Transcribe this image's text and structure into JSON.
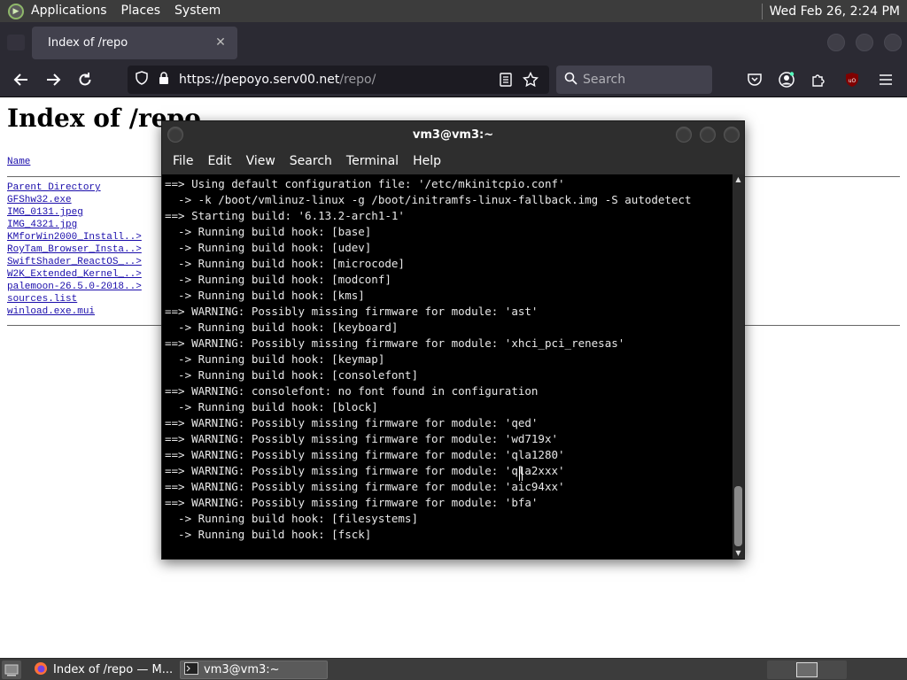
{
  "top_panel": {
    "menus": [
      "Applications",
      "Places",
      "System"
    ],
    "clock": "Wed Feb 26,  2:24 PM"
  },
  "browser": {
    "tab_title": "Index of /repo",
    "url_host": "https://pepoyo.serv00.net",
    "url_path": "/repo/",
    "search_placeholder": "Search"
  },
  "page": {
    "heading": "Index of /repo",
    "column_name": "Name",
    "files": [
      "Parent Directory",
      "GFShw32.exe",
      "IMG_0131.jpeg",
      "IMG_4321.jpg",
      "KMforWin2000_Install..>",
      "RoyTam_Browser_Insta..>",
      "SwiftShader_ReactOS_..>",
      "W2K_Extended_Kernel_..>",
      "palemoon-26.5.0-2018..>",
      "sources.list",
      "winload.exe.mui"
    ]
  },
  "terminal": {
    "title": "vm3@vm3:~",
    "menu": [
      "File",
      "Edit",
      "View",
      "Search",
      "Terminal",
      "Help"
    ],
    "lines": [
      "==> Using default configuration file: '/etc/mkinitcpio.conf'",
      "  -> -k /boot/vmlinuz-linux -g /boot/initramfs-linux-fallback.img -S autodetect",
      "==> Starting build: '6.13.2-arch1-1'",
      "  -> Running build hook: [base]",
      "  -> Running build hook: [udev]",
      "  -> Running build hook: [microcode]",
      "  -> Running build hook: [modconf]",
      "  -> Running build hook: [kms]",
      "==> WARNING: Possibly missing firmware for module: 'ast'",
      "  -> Running build hook: [keyboard]",
      "==> WARNING: Possibly missing firmware for module: 'xhci_pci_renesas'",
      "  -> Running build hook: [keymap]",
      "  -> Running build hook: [consolefont]",
      "==> WARNING: consolefont: no font found in configuration",
      "  -> Running build hook: [block]",
      "==> WARNING: Possibly missing firmware for module: 'qed'",
      "==> WARNING: Possibly missing firmware for module: 'wd719x'",
      "==> WARNING: Possibly missing firmware for module: 'qla1280'",
      "==> WARNING: Possibly missing firmware for module: 'qla2xxx'",
      "==> WARNING: Possibly missing firmware for module: 'aic94xx'",
      "==> WARNING: Possibly missing firmware for module: 'bfa'",
      "  -> Running build hook: [filesystems]",
      "  -> Running build hook: [fsck]"
    ]
  },
  "taskbar": {
    "tasks": [
      "Index of /repo — M...",
      "vm3@vm3:~"
    ]
  }
}
